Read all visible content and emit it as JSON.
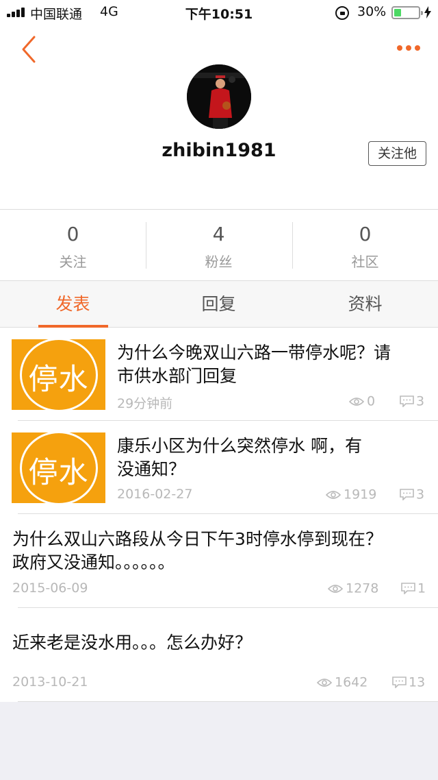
{
  "status_bar": {
    "carrier": "中国联通",
    "network": "4G",
    "time": "下午10:51",
    "battery_percent": "30%",
    "battery_level": 0.3
  },
  "profile": {
    "username": "zhibin1981",
    "follow_label": "关注他",
    "accent_color": "#f0682a"
  },
  "stats": [
    {
      "value": "0",
      "label": "关注"
    },
    {
      "value": "4",
      "label": "粉丝"
    },
    {
      "value": "0",
      "label": "社区"
    }
  ],
  "tabs": [
    {
      "label": "发表",
      "active": true
    },
    {
      "label": "回复",
      "active": false
    },
    {
      "label": "资料",
      "active": false
    }
  ],
  "posts": [
    {
      "thumb_text": "停水",
      "title_line1": "为什么今晚双山六路一带停水呢？请",
      "title_line2": "市供水部门回复",
      "date": "29分钟前",
      "views": "0",
      "replies": "3"
    },
    {
      "thumb_text": "停水",
      "title_line1": "康乐小区为什么突然停水 啊，有",
      "title_line2": "没通知？",
      "date": "2016-02-27",
      "views": "1919",
      "replies": "3"
    },
    {
      "title_line1": "为什么双山六路段从今日下午3时停水停到现在？",
      "title_line2": "政府又没通知。。。。。。",
      "date": "2015-06-09",
      "views": "1278",
      "replies": "1"
    },
    {
      "title_line1": "近来老是没水用。。。怎么办好？",
      "date": "2013-10-21",
      "views": "1642",
      "replies": "13"
    }
  ]
}
